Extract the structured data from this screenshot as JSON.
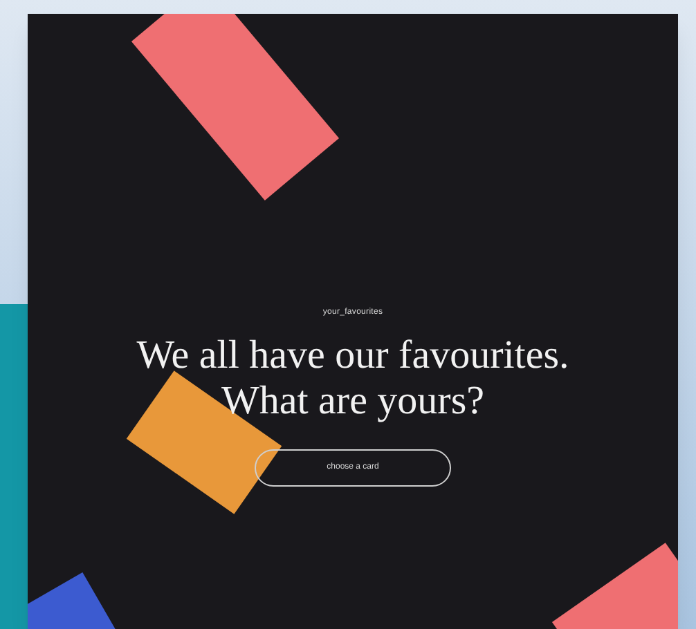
{
  "hero": {
    "eyebrow": "your_favourites",
    "heading_lines": [
      "We all have our favourites.",
      "What are yours?"
    ],
    "button": "choose a card"
  }
}
